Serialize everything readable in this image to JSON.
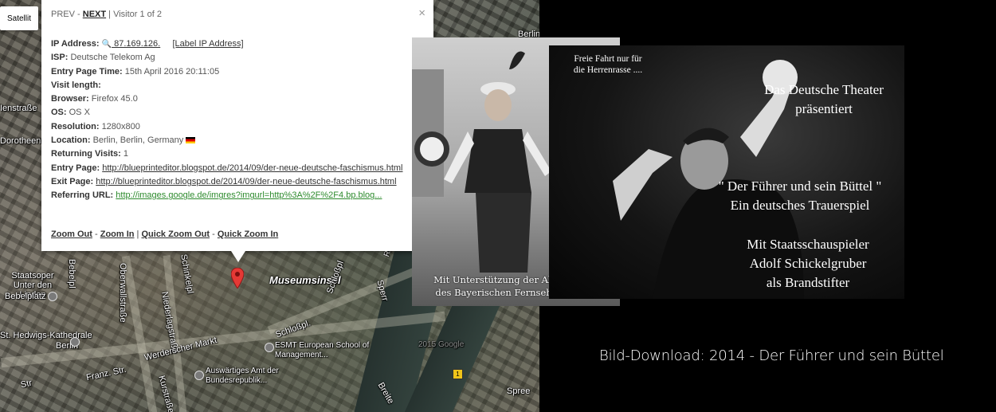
{
  "map": {
    "satellite_label": "Satellit",
    "labels": [
      "Berlin",
      "Ienstraße",
      "Dorotheens",
      "Staatsoper Unter den Linden",
      "Bebelplatz",
      "Bebelpl",
      "Oberwallstraße",
      "Niederlagstraße",
      "Schinkelpl",
      "Museumsinsel",
      "Schloßpl",
      "Schloßpl.",
      "Sperr",
      "St. Hedwigs-Kathedrale",
      "Berlin",
      "Werderscher Markt",
      "Franz. Str.",
      "Str",
      "ESMT European School of Management...",
      "Auswärtiges Amt der Bundesrepublik...",
      "Kurstraße",
      "Breite",
      "Spree",
      "Rathaus",
      "2015 Google"
    ],
    "transit_badge": "1",
    "marker_icon": "map-pin-icon"
  },
  "info": {
    "prev": "PREV",
    "sep": " - ",
    "next": "NEXT",
    "visitor": " | Visitor 1 of 2",
    "close": "×",
    "ip_label": "IP Address:",
    "ip_value": " 87.169.126.",
    "ip_link": "[Label IP Address]",
    "isp_label": "ISP:",
    "isp_value": "Deutsche Telekom Ag",
    "entry_time_label": "Entry Page Time:",
    "entry_time_value": "15th April 2016 20:11:05",
    "visit_length_label": "Visit length:",
    "browser_label": "Browser:",
    "browser_value": "Firefox 45.0",
    "os_label": "OS:",
    "os_value": "OS X",
    "resolution_label": "Resolution:",
    "resolution_value": "1280x800",
    "location_label": "Location:",
    "location_value": "Berlin, Berlin, Germany",
    "returning_label": "Returning Visits:",
    "returning_value": "1",
    "entry_page_label": "Entry Page:",
    "entry_page_value": "http://blueprinteditor.blogspot.de/2014/09/der-neue-deutsche-faschismus.html",
    "exit_page_label": "Exit Page:",
    "exit_page_value": "http://blueprinteditor.blogspot.de/2014/09/der-neue-deutsche-faschismus.html",
    "referring_label": "Referring URL:",
    "referring_value": "http://images.google.de/imgres?imgurl=http%3A%2F%2F4.bp.blog...",
    "zoom_out": "Zoom Out",
    "zoom_in": "Zoom In",
    "quick_zoom_out": "Quick Zoom Out",
    "quick_zoom_in": "Quick Zoom In",
    "sep_pipe": " | "
  },
  "photo1": {
    "caption_line1": "Mit Unterstützung der Abendschau",
    "caption_line2": "des Bayerischen Fernsehens - BR -"
  },
  "poster": {
    "freie_line1": "Freie Fahrt nur für",
    "freie_line2": "die Herrenrasse ....",
    "t1_line1": "Das Deutsche Theater",
    "t1_line2": "präsentiert",
    "t2_line1": "\" Der Führer und sein Büttel \"",
    "t2_line2": "Ein deutsches Trauerspiel",
    "t3_line1": "Mit Staatsschauspieler",
    "t3_line2": "Adolf Schickelgruber",
    "t3_line3": "als Brandstifter"
  },
  "download_text": "Bild-Download: 2014 - Der Führer und sein Büttel"
}
